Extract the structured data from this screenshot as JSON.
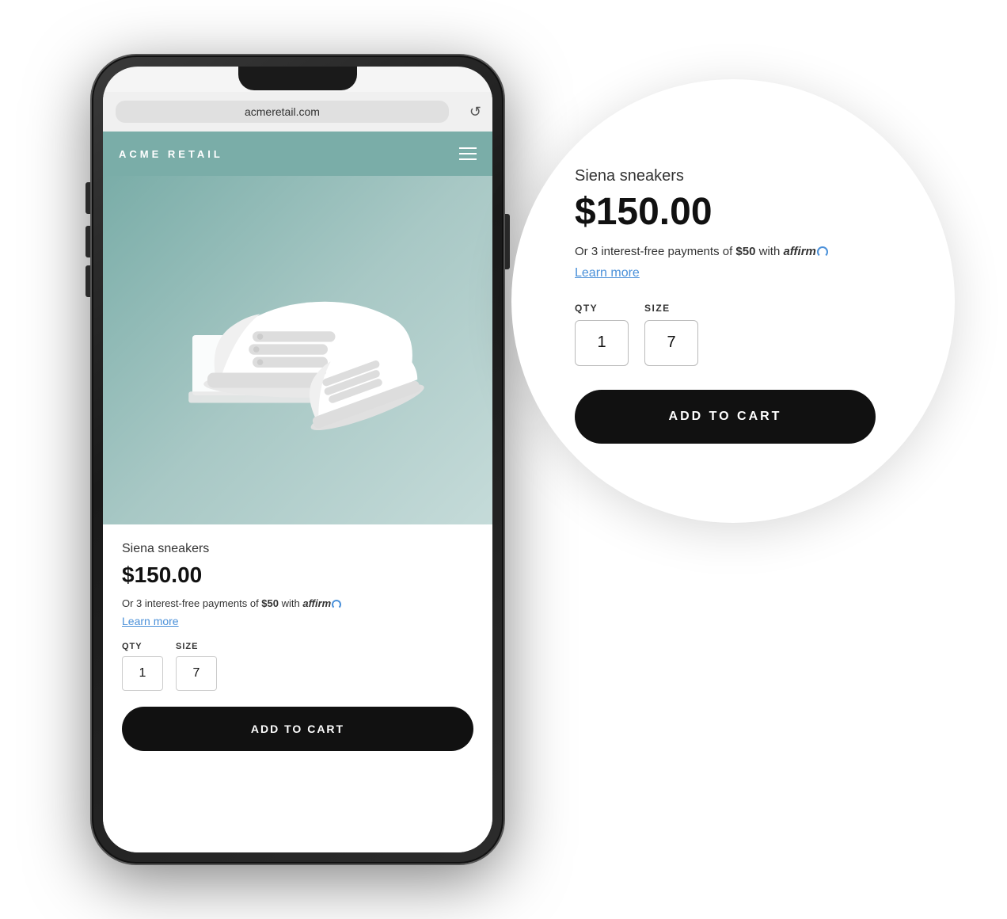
{
  "browser": {
    "url": "acmeretail.com",
    "refresh_icon": "↺"
  },
  "site": {
    "brand": "ACME RETAIL",
    "menu_label": "menu"
  },
  "product": {
    "name": "Siena sneakers",
    "price": "$150.00",
    "affirm_text_prefix": "Or 3 interest-free payments of ",
    "affirm_amount": "$50",
    "affirm_text_suffix": " with ",
    "affirm_brand": "affirm",
    "learn_more": "Learn more",
    "qty_label": "QTY",
    "size_label": "SIZE",
    "qty_value": "1",
    "size_value": "7",
    "add_to_cart": "ADD TO CART"
  },
  "zoom": {
    "product_name": "Siena sneakers",
    "price": "$150.00",
    "affirm_text_prefix": "Or 3 interest-free payments of ",
    "affirm_amount": "$50",
    "affirm_text_suffix": " with ",
    "affirm_brand": "affirm",
    "learn_more": "Learn more",
    "qty_label": "QTY",
    "size_label": "SIZE",
    "qty_value": "1",
    "size_value": "7",
    "add_to_cart": "ADD TO CART"
  },
  "colors": {
    "header_bg": "#7aada8",
    "button_bg": "#111111",
    "button_text": "#ffffff",
    "link_color": "#4a90d9",
    "price_color": "#111111"
  }
}
